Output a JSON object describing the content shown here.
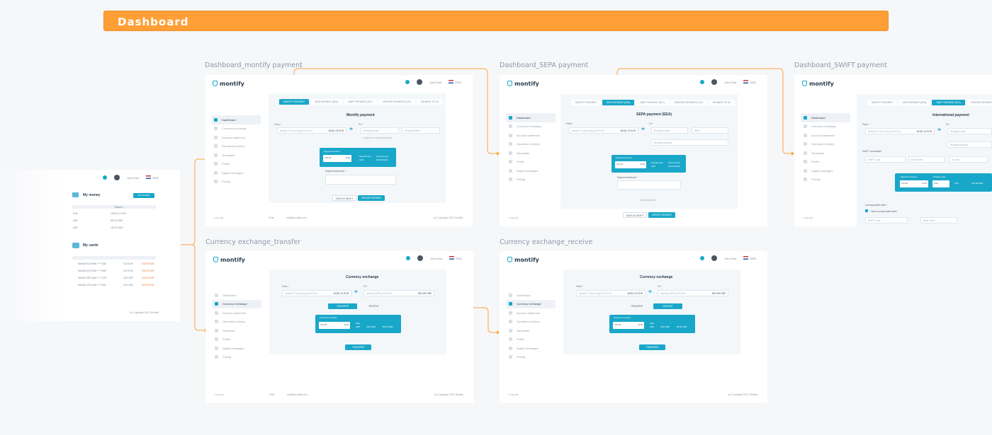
{
  "banner": {
    "title": "Dashboard"
  },
  "frames": {
    "montify": "Dashboard_montify payment",
    "sepa": "Dashboard_SEPA payment",
    "swift": "Dashboard_SWIFT payment",
    "transfer": "Currency exchange_transfer",
    "receive": "Currency exchange_receive"
  },
  "app": {
    "logo": "montify",
    "user": "John Doe",
    "lang": "ENG",
    "logout": "Log out",
    "copyright": "(c) Copyright 2021 Montify",
    "email": "mail@montify.com",
    "chat": "Chat"
  },
  "sidebar": [
    "Dashboard",
    "Currency exchange",
    "Account statement",
    "Operations history",
    "Templates",
    "Profile",
    "Digital messages",
    "Pricing"
  ],
  "payment_tabs": [
    "MONTIFY PAYMENT",
    "SEPA PAYMENT (EEA)",
    "SWIFT PAYMENT (INT.)",
    "CREATED PAYMENTS (XX)",
    "PAYMENT TO XX"
  ],
  "montify": {
    "title": "Montify payment",
    "from": "From *",
    "to": "To *",
    "from_acc": "Montify TX (Sub Acq) (XXXXXX)",
    "from_val": "18 821.21 EUR",
    "recipient_name": "Recipient name",
    "recipient_iban": "Recipient IBAN",
    "hint": "Payment to recently account",
    "amount_label": "Payment amount",
    "amount_val": "100,00",
    "currency": "EUR",
    "fee_label": "Payment fee",
    "fee_val": "0,00",
    "total_label": "Total amount",
    "total_val": "100,00 EUR",
    "reference": "Payment reference *",
    "save": "SAVE AS DRAFT",
    "create": "CREATE PAYMENT"
  },
  "sepa": {
    "title": "SEPA payment (EEA)",
    "recipient_name": "Recipient name",
    "iban": "IBAN",
    "recipient_address": "Recipient address",
    "checkbox": "Instant payment",
    "save": "SAVE AS DRAFT",
    "create": "CREATE PAYMENT"
  },
  "swift": {
    "title": "International payment",
    "swift_label": "SWIFT credentials *",
    "swift_code": "SWIFT code",
    "bank_name": "Bank name",
    "country": "Country",
    "charges": "Charges type",
    "charges_val": "SHA",
    "correspondent": "Correspondent bank *",
    "corr_check": "I have correspondent bank"
  },
  "exchange": {
    "title": "Currency exchange",
    "from": "From *",
    "to": "To *",
    "from_acc": "Montify TX (Sub Acq) (XXXXXX)",
    "from_val": "18 821.21 EUR",
    "to_acc": "Montify (GBP) (XXXXXX)",
    "to_val": "820.530 GBP",
    "transfer": "TRANSFER",
    "receive": "RECEIVE",
    "amount_transfer": "Amount to transfer",
    "amount_receive": "Amount to receive",
    "rate_label": "Rate",
    "rate_val": "0,85",
    "fee_val": "0,00 GBP",
    "total_val": "85,00 GBP",
    "amount": "100,00",
    "currency": "EUR",
    "button": "TRANSFER"
  },
  "left": {
    "money": "My money",
    "cards": "My cards",
    "balance": "Balance",
    "currency_btn": "EXCHANGE",
    "money_rows": [
      {
        "c": "EUR",
        "v": "18 821.21 EUR"
      },
      {
        "c": "GBP",
        "v": "820.53 GBP"
      },
      {
        "c": "USD",
        "v": "100.00 USD"
      }
    ],
    "card_rows": [
      {
        "n": "Montify EUR Debit **** 3340",
        "v": "0.00 EUR",
        "o": "100.00 EUR"
      },
      {
        "n": "Montify EUR Debit **** 0942",
        "v": "0.00 EUR",
        "o": "100.00 EUR"
      },
      {
        "n": "Montify GBP Debit **** 1138",
        "v": "0.00 GBP",
        "o": "100.00 EUR"
      },
      {
        "n": "Montify USD Debit **** 6011",
        "v": "0.00 USD",
        "o": "100.00 EUR"
      }
    ]
  }
}
